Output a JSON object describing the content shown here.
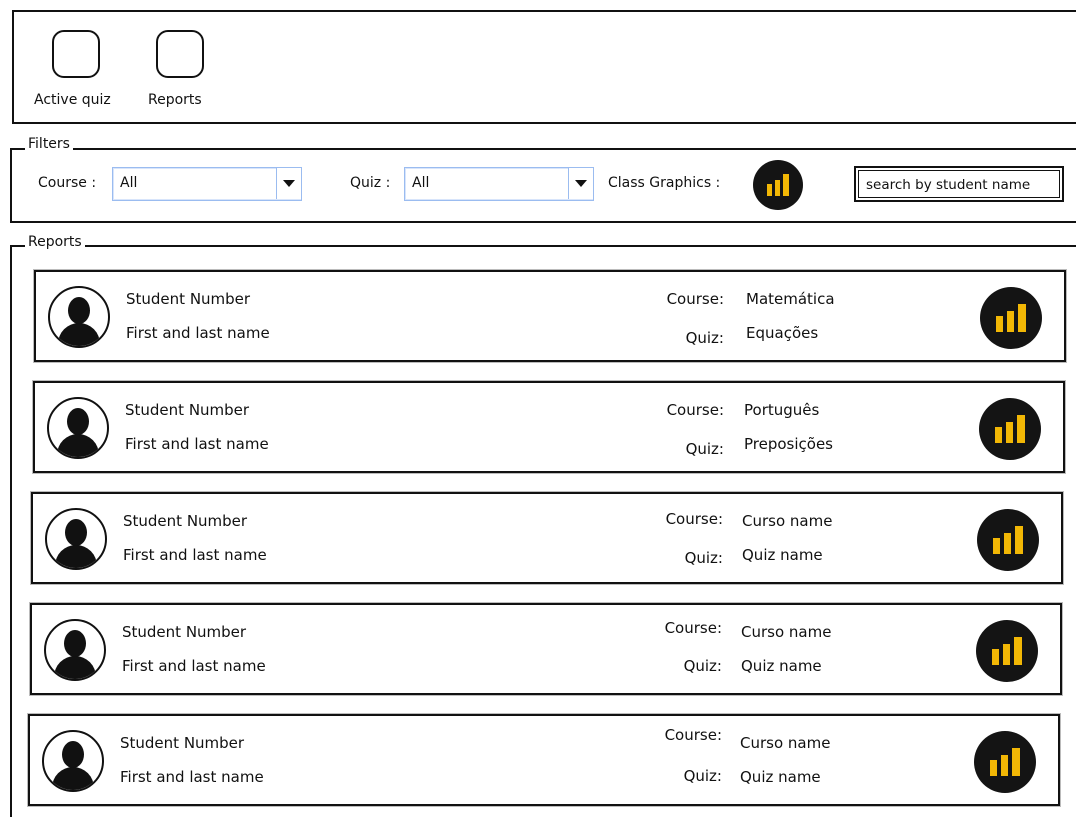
{
  "toolbar": {
    "buttons": [
      {
        "label": "Active quiz"
      },
      {
        "label": "Reports"
      }
    ]
  },
  "filters": {
    "legend": "Filters",
    "course_label": "Course :",
    "course_value": "All",
    "quiz_label": "Quiz :",
    "quiz_value": "All",
    "class_graphics_label": "Class Graphics :",
    "search_placeholder": "search by student name"
  },
  "reports": {
    "legend": "Reports",
    "course_label": "Course:",
    "quiz_label": "Quiz:",
    "items": [
      {
        "student_number": "Student Number",
        "name": "First and last name",
        "course": "Matemática",
        "quiz": "Equações"
      },
      {
        "student_number": "Student Number",
        "name": "First and last name",
        "course": "Português",
        "quiz": "Preposições"
      },
      {
        "student_number": "Student Number",
        "name": "First and last name",
        "course": "Curso name",
        "quiz": "Quiz name"
      },
      {
        "student_number": "Student Number",
        "name": "First and last name",
        "course": "Curso name",
        "quiz": "Quiz name"
      },
      {
        "student_number": "Student Number",
        "name": "First and last name",
        "course": "Curso name",
        "quiz": "Quiz name"
      }
    ]
  },
  "colors": {
    "chart_icon_bg": "#141414",
    "chart_icon_bars": "#f2b705",
    "select_border": "#9bbcf0"
  },
  "icons": {
    "toolbar_button": "rounded-square-icon",
    "avatar": "user-silhouette-icon",
    "graphics": "bar-chart-icon",
    "dropdown": "chevron-down-icon"
  }
}
